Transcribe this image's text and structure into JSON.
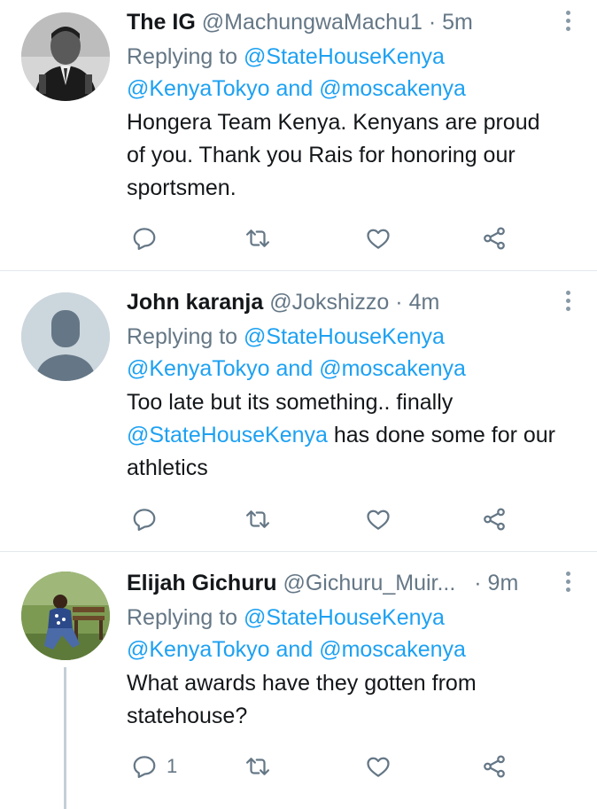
{
  "icons": {
    "reply": "reply-icon",
    "retweet": "retweet-icon",
    "like": "heart-icon",
    "share": "share-icon",
    "more": "more-vertical-icon"
  },
  "tweets": [
    {
      "name": "The IG",
      "handle": "@MachungwaMachu1",
      "sep": " · ",
      "time": "5m",
      "replying_prefix": "Replying to ",
      "replying_to_1": "@StateHouseKenya",
      "replying_to_2": "@KenyaTokyo",
      "replying_and": " and ",
      "replying_to_3": "@moscakenya",
      "text": "Hongera Team Kenya. Kenyans are proud of you. Thank you Rais for honoring our sportsmen.",
      "reply_count": ""
    },
    {
      "name": "John karanja",
      "handle": "@Jokshizzo",
      "sep": " · ",
      "time": "4m",
      "replying_prefix": "Replying to ",
      "replying_to_1": "@StateHouseKenya",
      "replying_to_2": "@KenyaTokyo",
      "replying_and": " and ",
      "replying_to_3": "@moscakenya",
      "text_part1": "Too late but its something.. finally ",
      "text_mention": "@StateHouseKenya",
      "text_part2": " has done some for our athletics",
      "reply_count": ""
    },
    {
      "name": "Elijah Gichuru",
      "handle": "@Gichuru_Muir...",
      "sep": " · ",
      "time": "9m",
      "replying_prefix": "Replying to ",
      "replying_to_1": "@StateHouseKenya",
      "replying_to_2": "@KenyaTokyo",
      "replying_and": " and ",
      "replying_to_3": "@moscakenya",
      "text": "What awards have they gotten from statehouse?",
      "reply_count": "1"
    }
  ]
}
